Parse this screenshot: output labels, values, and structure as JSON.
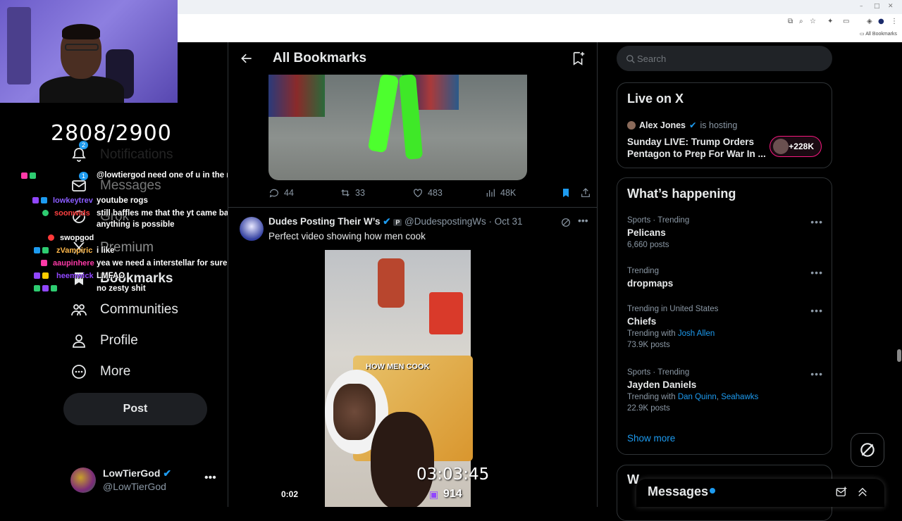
{
  "browser": {
    "bookmarks_bar_item": "All Bookmarks"
  },
  "stream": {
    "sub_counter": "2808/2900",
    "timer": "03:03:45",
    "viewers": "914",
    "chat": [
      {
        "user": "",
        "message": "@lowtiergod need one of u in the movie interstellar",
        "color": "#9147ff"
      },
      {
        "user": "lowkeytrev",
        "message": "youtube rogs",
        "color": "#8a5cff"
      },
      {
        "user": "soonwids",
        "message": "still baffles me that the yt came back, anything is possible",
        "color": "#ff4040"
      },
      {
        "user": "swopgod",
        "message": "",
        "color": "#ffffff"
      },
      {
        "user": "zVampiric",
        "message": "i like",
        "color": "#ffb84a"
      },
      {
        "user": "aaupinhere",
        "message": "yea we need a interstellar for sure",
        "color": "#ff3aa8"
      },
      {
        "user": "heemwick",
        "message": "LMFAO",
        "color": "#9147ff"
      },
      {
        "user": "",
        "message": "no zesty shit",
        "color": "#ffffff"
      }
    ]
  },
  "leftnav": {
    "items": [
      {
        "label": "Notifications",
        "icon": "bell-icon"
      },
      {
        "label": "Messages",
        "icon": "mail-icon"
      },
      {
        "label": "Grok",
        "icon": "grok-icon"
      },
      {
        "label": "Premium",
        "icon": "x-icon"
      },
      {
        "label": "Bookmarks",
        "icon": "bookmark-icon"
      },
      {
        "label": "Communities",
        "icon": "communities-icon"
      },
      {
        "label": "Profile",
        "icon": "profile-icon"
      },
      {
        "label": "More",
        "icon": "more-circle-icon"
      }
    ],
    "notification_badge": "2",
    "messages_badge": "1",
    "post_label": "Post",
    "account": {
      "name": "LowTierGod",
      "handle": "@LowTierGod"
    }
  },
  "main": {
    "title": "All Bookmarks",
    "tweet1": {
      "replies": "44",
      "reposts": "33",
      "likes": "483",
      "views": "48K"
    },
    "tweet2": {
      "name": "Dudes Posting Their W’s",
      "handle": "@DudespostingWs",
      "date": "Oct 31",
      "meta": "@DudespostingWs · Oct 31",
      "text": "Perfect video showing  how men cook",
      "video_caption": "HOW MEN COOK",
      "video_time": "0:02"
    }
  },
  "right": {
    "search_placeholder": "Search",
    "live": {
      "title": "Live on X",
      "host": "Alex Jones",
      "hosting": "is hosting",
      "headline": "Sunday LIVE: Trump Orders Pentagon to Prep For War In ...",
      "count": "+228K"
    },
    "trends_title": "What’s happening",
    "trends": [
      {
        "category": "Sports · Trending",
        "name": "Pelicans",
        "sub": "6,660 posts"
      },
      {
        "category": "Trending",
        "name": "dropmaps",
        "sub": ""
      },
      {
        "category": "Trending in United States",
        "name": "Chiefs",
        "trending_with": "Trending with",
        "links": [
          "Josh Allen"
        ],
        "sub": "73.9K posts"
      },
      {
        "category": "Sports · Trending",
        "name": "Jayden Daniels",
        "trending_with": "Trending with",
        "links": [
          "Dan Quinn",
          "Seahawks"
        ],
        "sub": "22.9K posts"
      }
    ],
    "show_more": "Show more",
    "whos_partial": "W",
    "messages_title": "Messages"
  },
  "colors": {
    "accent": "#1d9bf0",
    "bg": "#000000",
    "text": "#e7e9ea",
    "muted": "#8b98a5",
    "live_pink": "#f91880"
  }
}
